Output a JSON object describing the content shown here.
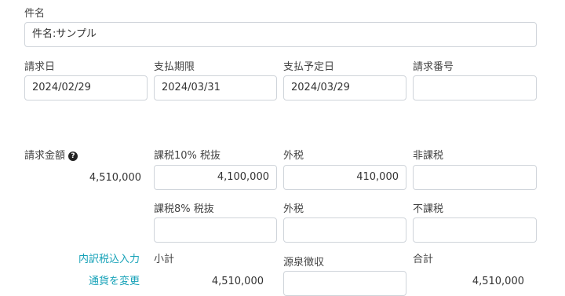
{
  "subject": {
    "label": "件名",
    "value": "件名:サンプル"
  },
  "dates": {
    "invoice_date": {
      "label": "請求日",
      "value": "2024/02/29"
    },
    "due_date": {
      "label": "支払期限",
      "value": "2024/03/31"
    },
    "scheduled_date": {
      "label": "支払予定日",
      "value": "2024/03/29"
    },
    "invoice_number": {
      "label": "請求番号",
      "value": ""
    }
  },
  "amount": {
    "label": "請求金額",
    "help_icon": "question-circle-icon",
    "help_glyph": "?",
    "total": "4,510,000",
    "taxable10": {
      "label": "課税10% 税抜",
      "value": "4,100,000"
    },
    "tax10": {
      "label": "外税",
      "value": "410,000"
    },
    "non_taxable": {
      "label": "非課税",
      "value": ""
    },
    "taxable8": {
      "label": "課税8% 税抜",
      "value": ""
    },
    "tax8": {
      "label": "外税",
      "value": ""
    },
    "tax_exempt": {
      "label": "不課税",
      "value": ""
    }
  },
  "breakdown": {
    "tax_included_link": "内訳税込入力",
    "subtotal": {
      "label": "小計",
      "value": "4,510,000"
    },
    "withholding": {
      "label": "源泉徴収",
      "value": ""
    },
    "grand_total": {
      "label": "合計",
      "value": "4,510,000"
    },
    "currency_link": "通貨を変更"
  },
  "colors": {
    "link": "#17a2b8",
    "border": "#cfd4da"
  }
}
